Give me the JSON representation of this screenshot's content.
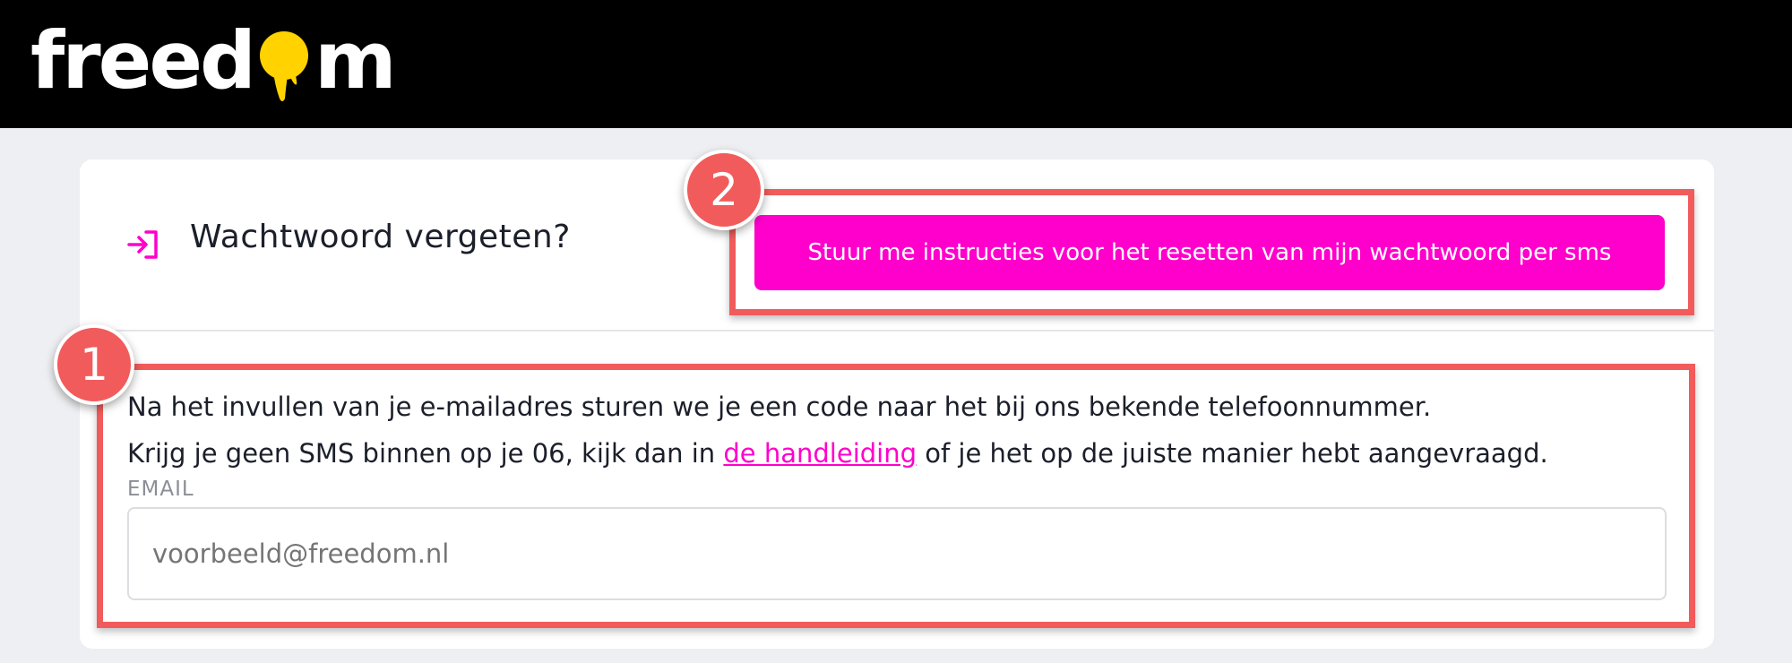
{
  "header": {
    "logo_left": "freed",
    "logo_right": "m"
  },
  "card": {
    "title": "Wachtwoord vergeten?",
    "sms_button_label": "Stuur me instructies voor het resetten van mijn wachtwoord per sms",
    "line1": "Na het invullen van je e-mailadres sturen we je een code naar het bij ons bekende telefoonnummer.",
    "line2_before": "Krijg je geen SMS binnen op je 06, kijk dan in ",
    "line2_link": "de handleiding",
    "line2_after": " of je het op de juiste manier hebt aangevraagd.",
    "email_label": "EMAIL",
    "email_placeholder": "voorbeeld@freedom.nl"
  },
  "annotations": [
    {
      "number": "1"
    },
    {
      "number": "2"
    }
  ],
  "colors": {
    "accent": "#ff00cc",
    "logo_drop": "#ffd200",
    "annotation": "#f25b5b",
    "header_bg": "#000000"
  }
}
